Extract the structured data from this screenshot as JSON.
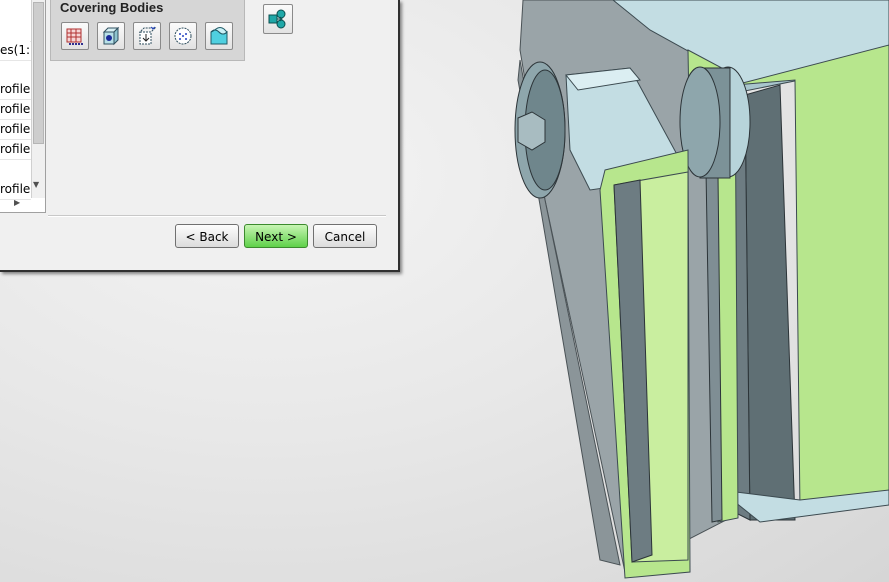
{
  "list": {
    "rows": [
      "≡",
      "es(1:",
      "rofile",
      "rofile",
      "rofile",
      "rofile",
      "rofile"
    ]
  },
  "covering_group": {
    "title": "Covering Bodies",
    "tools": [
      "mesh-grid-icon",
      "solid-body-icon",
      "cube-arrow-icon",
      "circle-points-icon",
      "wavy-surface-icon"
    ]
  },
  "side_tool": {
    "icon": "body-select-icon"
  },
  "buttons": {
    "back": "< Back",
    "next": "Next >",
    "cancel": "Cancel"
  },
  "colors": {
    "accent_green": "#b7e68d",
    "steel": "#6b8088",
    "light_steel": "#c6dde2"
  }
}
